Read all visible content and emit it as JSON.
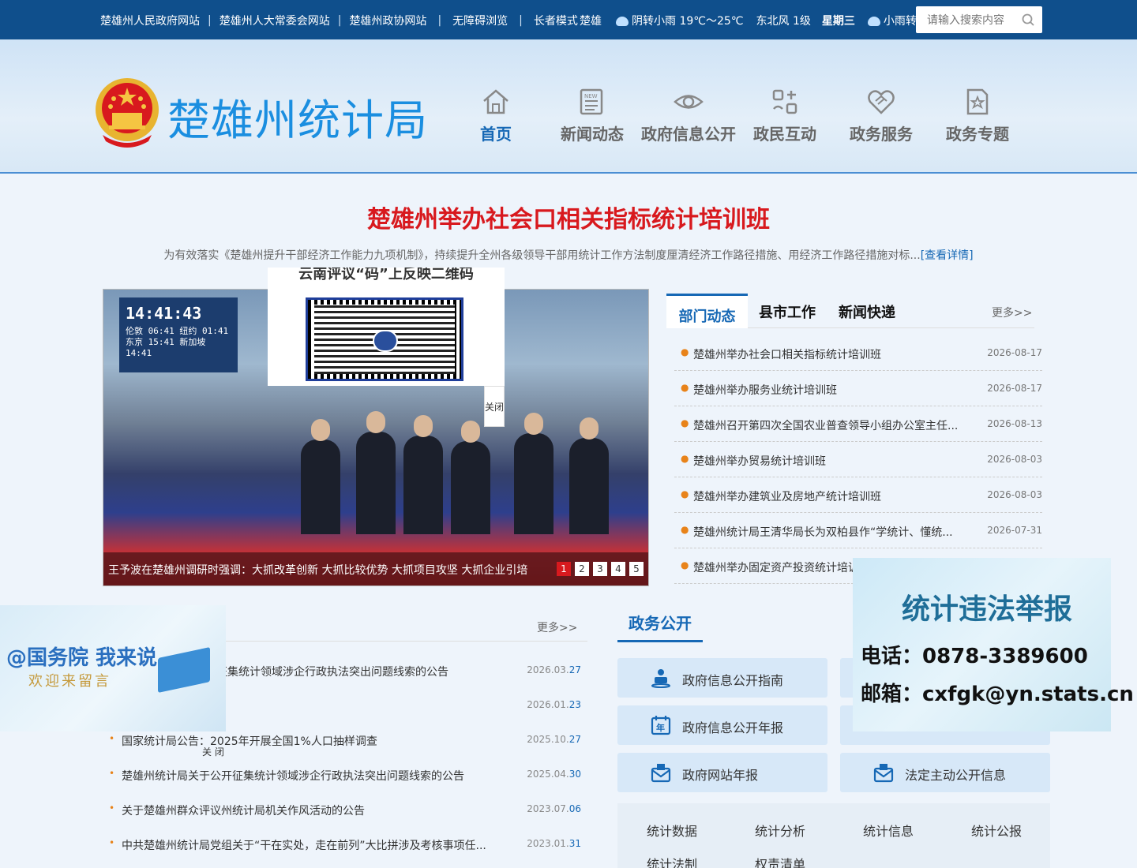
{
  "topbar": {
    "links": [
      "楚雄州人民政府网站",
      "楚雄州人大常委会网站",
      "楚雄州政协网站",
      "无障碍浏览",
      "长者模式"
    ],
    "separators": [
      "|",
      "|",
      "|",
      "|"
    ],
    "city": "楚雄",
    "weather_today": "阴转小雨 19℃～25℃",
    "wind": "东北风 1级",
    "weekday": "星期三",
    "weather_tomorrow": "小雨转中雨",
    "search_placeholder": "请输入搜索内容"
  },
  "header": {
    "site_name": "楚雄州统计局",
    "nav": [
      {
        "label": "首页",
        "icon": "home-icon",
        "active": true
      },
      {
        "label": "新闻动态",
        "icon": "news-icon"
      },
      {
        "label": "政府信息公开",
        "icon": "eye-icon"
      },
      {
        "label": "政民互动",
        "icon": "interaction-icon"
      },
      {
        "label": "政务服务",
        "icon": "handshake-icon"
      },
      {
        "label": "政务专题",
        "icon": "topic-icon"
      }
    ]
  },
  "headline": {
    "title": "楚雄州举办社会口相关指标统计培训班",
    "summary": "为有效落实《楚雄州提升干部经济工作能力九项机制》，持续提升全州各级领导干部用统计工作方法制度厘清经济工作路径措施、用经济工作路径措施对标...",
    "detail_link": "[查看详情]"
  },
  "slider": {
    "screen_clock": "14:41:43",
    "screen_rows": [
      "伦敦 06:41  纽约 01:41",
      "东京 15:41  新加坡 14:41"
    ],
    "caption": "王予波在楚雄州调研时强调：大抓改革创新 大抓比较优势 大抓项目攻坚 大抓企业引培",
    "pages": [
      "1",
      "2",
      "3",
      "4",
      "5"
    ],
    "current_page": 1
  },
  "qr_popup": {
    "title": "云南评议“码”上反映二维码",
    "close": "关闭"
  },
  "news": {
    "tabs": [
      "部门动态",
      "县市工作",
      "新闻快递"
    ],
    "more": "更多>>",
    "items": [
      {
        "title": "楚雄州举办社会口相关指标统计培训班",
        "date": "2026-08-17"
      },
      {
        "title": "楚雄州举办服务业统计培训班",
        "date": "2026-08-17"
      },
      {
        "title": "楚雄州召开第四次全国农业普查领导小组办公室主任...",
        "date": "2026-08-13"
      },
      {
        "title": "楚雄州举办贸易统计培训班",
        "date": "2026-08-03"
      },
      {
        "title": "楚雄州举办建筑业及房地产统计培训班",
        "date": "2026-08-03"
      },
      {
        "title": "楚雄州统计局王清华局长为双柏县作“学统计、懂统...",
        "date": "2026-07-31"
      },
      {
        "title": "楚雄州举办固定资产投资统计培训",
        "date": ""
      }
    ]
  },
  "report_float": {
    "title": "统计违法举报",
    "phone": "电话：0878-3389600",
    "email": "邮箱：cxfgk@yn.stats.cn"
  },
  "gwy_float": {
    "title": "@国务院 我来说",
    "subtitle": "欢迎来留言",
    "close": "关 闭"
  },
  "notices": {
    "more": "更多>>",
    "items": [
      {
        "title": "开征集统计领域涉企行政执法突出问题线索的公告",
        "date_prefix": "2026.03.",
        "date_day": "27"
      },
      {
        "title": "",
        "date_prefix": "2026.01.",
        "date_day": "23"
      },
      {
        "title": "国家统计局公告：2025年开展全国1%人口抽样调查",
        "date_prefix": "2025.10.",
        "date_day": "27"
      },
      {
        "title": "楚雄州统计局关于公开征集统计领域涉企行政执法突出问题线索的公告",
        "date_prefix": "2025.04.",
        "date_day": "30"
      },
      {
        "title": "关于楚雄州群众评议州统计局机关作风活动的公告",
        "date_prefix": "2023.07.",
        "date_day": "06"
      },
      {
        "title": "中共楚雄州统计局党组关于“干在实处，走在前列”大比拼涉及考核事项任...",
        "date_prefix": "2023.01.",
        "date_day": "31"
      }
    ]
  },
  "zwgk": {
    "title": "政务公开",
    "buttons": [
      {
        "label": "政府信息公开指南",
        "icon": "guide-icon"
      },
      {
        "label": "",
        "icon": "hidden-icon"
      },
      {
        "label": "政府信息公开年报",
        "icon": "calendar-year-icon"
      },
      {
        "label": "",
        "icon": "hidden-icon"
      },
      {
        "label": "政府网站年报",
        "icon": "mail-report-icon"
      },
      {
        "label": "法定主动公开信息",
        "icon": "mail-report-icon"
      }
    ],
    "stats": [
      "统计数据",
      "统计分析",
      "统计信息",
      "统计公报",
      "统计法制",
      "权责清单"
    ]
  },
  "colors": {
    "topbar": "#0f4f8c",
    "accent": "#1668b5",
    "headline": "#d8191e",
    "bullet": "#e8831a"
  }
}
